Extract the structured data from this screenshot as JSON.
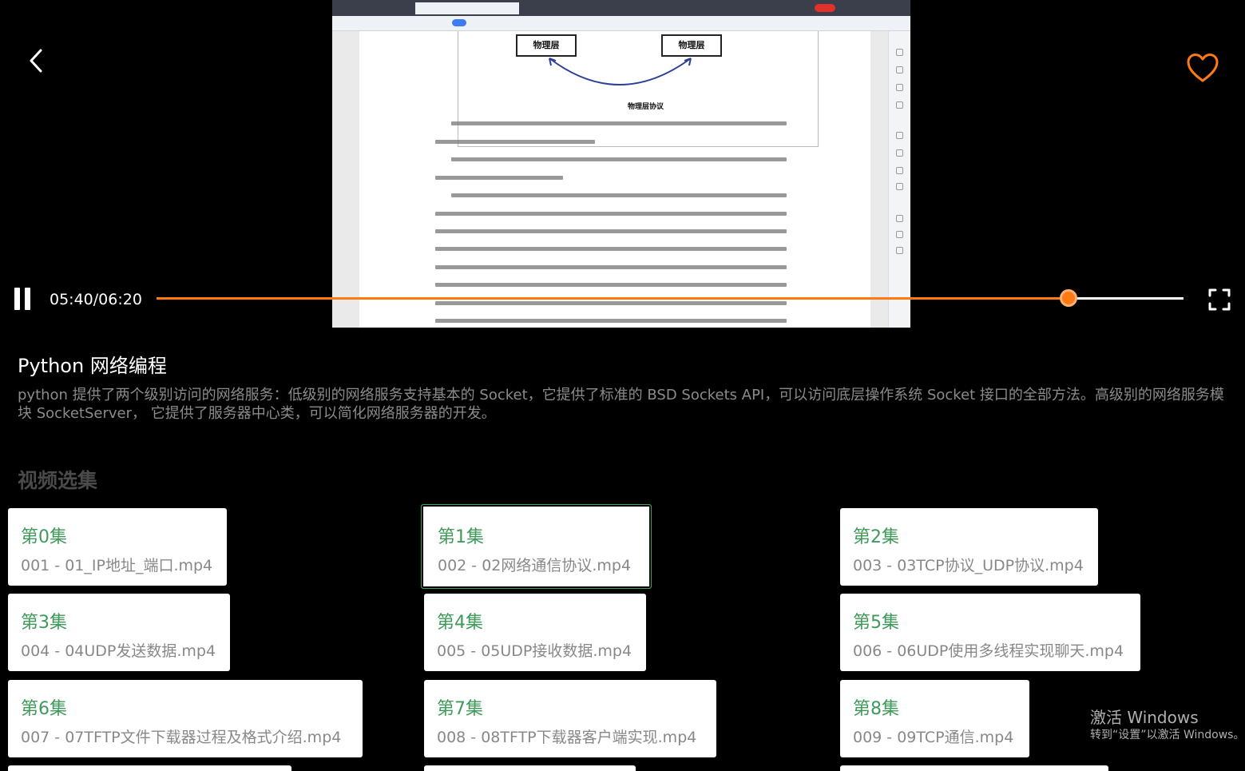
{
  "player": {
    "time_display": "05:40/06:20",
    "progress_fraction": 0.888,
    "accent_color": "#ff7a12",
    "video_frame": {
      "diagram_box_left": "物理层",
      "diagram_box_right": "物理层",
      "diagram_arrow_label": "物理层协议"
    }
  },
  "course": {
    "title": "Python 网络编程",
    "description": "python 提供了两个级别访问的网络服务：低级别的网络服务支持基本的 Socket，它提供了标准的 BSD Sockets API，可以访问底层操作系统 Socket 接口的全部方法。高级别的网络服务模块 SocketServer， 它提供了服务器中心类，可以简化网络服务器的开发。"
  },
  "episodes_section": {
    "title": "视频选集",
    "selected_index": 1,
    "items": [
      {
        "title": "第0集",
        "file": "001 - 01_IP地址_端口.mp4"
      },
      {
        "title": "第1集",
        "file": "002 - 02网络通信协议.mp4"
      },
      {
        "title": "第2集",
        "file": "003 - 03TCP协议_UDP协议.mp4"
      },
      {
        "title": "第3集",
        "file": "004 - 04UDP发送数据.mp4"
      },
      {
        "title": "第4集",
        "file": "005 - 05UDP接收数据.mp4"
      },
      {
        "title": "第5集",
        "file": "006 - 06UDP使用多线程实现聊天.mp4"
      },
      {
        "title": "第6集",
        "file": "007 - 07TFTP文件下载器过程及格式介绍.mp4"
      },
      {
        "title": "第7集",
        "file": "008 - 08TFTP下载器客户端实现.mp4"
      },
      {
        "title": "第8集",
        "file": "009 - 09TCP通信.mp4"
      }
    ]
  },
  "watermark": {
    "title": "激活 Windows",
    "subtitle": "转到“设置”以激活 Windows。"
  },
  "icons": {
    "back": "chevron-left-icon",
    "favorite": "heart-icon",
    "pause": "pause-icon",
    "fullscreen": "fullscreen-icon"
  }
}
